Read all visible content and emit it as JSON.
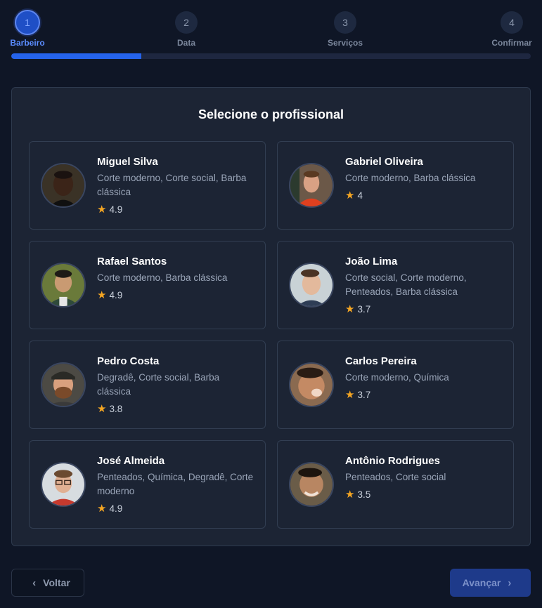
{
  "stepper": {
    "steps": [
      {
        "number": "1",
        "label": "Barbeiro"
      },
      {
        "number": "2",
        "label": "Data"
      },
      {
        "number": "3",
        "label": "Serviços"
      },
      {
        "number": "4",
        "label": "Confirmar"
      }
    ],
    "active_step": 1,
    "progress": 0.25
  },
  "panel": {
    "title": "Selecione o profissional",
    "barbers": [
      {
        "name": "Miguel Silva",
        "services": "Corte moderno, Corte social, Barba clássica",
        "rating": "4.9"
      },
      {
        "name": "Gabriel Oliveira",
        "services": "Corte moderno, Barba clássica",
        "rating": "4"
      },
      {
        "name": "Rafael Santos",
        "services": "Corte moderno, Barba clássica",
        "rating": "4.9"
      },
      {
        "name": "João Lima",
        "services": "Corte social, Corte moderno, Penteados, Barba clássica",
        "rating": "3.7"
      },
      {
        "name": "Pedro Costa",
        "services": "Degradê, Corte social, Barba clássica",
        "rating": "3.8"
      },
      {
        "name": "Carlos Pereira",
        "services": "Corte moderno, Química",
        "rating": "3.7"
      },
      {
        "name": "José Almeida",
        "services": "Penteados, Química, Degradê, Corte moderno",
        "rating": "4.9"
      },
      {
        "name": "Antônio Rodrigues",
        "services": "Penteados, Corte social",
        "rating": "3.5"
      }
    ]
  },
  "icons": {
    "star": "star-icon",
    "back": "chevron-left-icon",
    "next": "chevron-right-icon"
  },
  "footer": {
    "back_label": "Voltar",
    "next_label": "Avançar"
  },
  "colors": {
    "accent": "#2563eb",
    "star": "#f5a623",
    "background": "#0f1626",
    "panel": "#1c2434"
  }
}
